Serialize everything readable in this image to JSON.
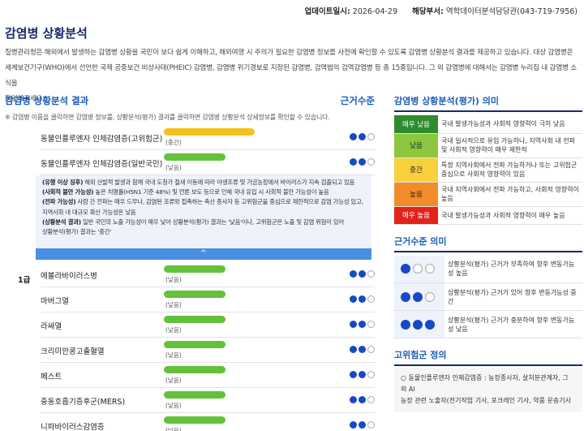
{
  "header": {
    "update_label": "업데이트일시:",
    "update_value": "2026-04-29",
    "dept_label": "해당부서:",
    "dept_value": "역학데이터분석담당관(043-719-7956)"
  },
  "page_title": "감염병 상황분석",
  "intro": [
    "질병관리청은 해외에서 발생하는 감염병 상황을 국민이 보다 쉽게 이해하고, 해외여행 시 주의가 필요한 감염병 정보를 사전에 확인할 수 있도록 감염병 상황분석 결과를 제공하고 있습니다. 대상 감염병은",
    "세계보건기구(WHO)에서 선언한 국제 공중보건 비상사태(PHEIC) 감염병, 감염병 위기경보로 지정된 감염병, 검역법의 검역감염병 등 총 15종입니다. 그 외 감염병에 대해서는 감염병 누리집 내 감염병 소식을",
    "확인해주세요."
  ],
  "left": {
    "title": "감염병 상황분석 결과",
    "evidence_col": "근거수준",
    "note": "※ 감염병 이름을 클릭하면 감염병 정보를, 상황분석(평가) 결과를 클릭하면 감염병 상황분석 상세정보를 확인할 수 있습니다.",
    "grade_label": "1급",
    "rows": [
      {
        "name": "동물인플루엔자 인체감염증(고위험군)",
        "level": "(중간)",
        "color": "yellow",
        "evidence": 2
      },
      {
        "name": "동물인플루엔자 인체감염증(일반국민)",
        "level": "(낮음)",
        "color": "green",
        "evidence": 2
      },
      {
        "name": "에볼라바이러스병",
        "level": "(낮음)",
        "color": "green",
        "evidence": 2
      },
      {
        "name": "마버그열",
        "level": "(낮음)",
        "color": "green",
        "evidence": 2
      },
      {
        "name": "라싸열",
        "level": "(낮음)",
        "color": "green",
        "evidence": 2
      },
      {
        "name": "크리미안콩고출혈열",
        "level": "(낮음)",
        "color": "green",
        "evidence": 2
      },
      {
        "name": "페스트",
        "level": "(낮음)",
        "color": "green",
        "evidence": 2
      },
      {
        "name": "중동호흡기증후군(MERS)",
        "level": "(낮음)",
        "color": "green",
        "evidence": 2
      },
      {
        "name": "니파바이러스감염증",
        "level": "(낮음)",
        "color": "green",
        "evidence": 2
      }
    ],
    "detail": [
      {
        "label": "(유행 이상 징후)",
        "text": " 해외 산발적 발생과 함께 국내 도청가 철새 이동에 따라 야생조류 및 가금농장에서 바이러스가 지속 검출되고 있음"
      },
      {
        "label": "(사회적 불안 가능성)",
        "text": " 높은 치명률(H5N1 기준 48%) 및 언론 보도 등으로 인해 국내 유입 시 사회적 불안 가능성이 높음"
      },
      {
        "label": "(전파 가능성)",
        "text": " 사람 간 전파는 매우 드무나, 감염된 조류와 접촉하는 축산 종사자 등 고위험군을 중심으로 제한적으로 감염 가능성 있고,"
      },
      {
        "label": "",
        "text": "지역사회 내 대규모 확산 가능성은 낮음"
      },
      {
        "label": "(상황분석 결과)",
        "text": " 일반 국민의 노출 가능성이 매우 낮아 상황분석(평가) 결과는 '낮음'이나, 고위험군은 노출 및 감염 위험이 있어"
      },
      {
        "label": "",
        "text": "상황분석(평가) 결과는 '중간'"
      }
    ],
    "collapse_symbol": "^"
  },
  "meaning": {
    "title": "감염병 상황분석(평가) 의미",
    "rows": [
      {
        "label": "매우 낮음",
        "color": "#2e8b2e",
        "text_color": "#ffffff",
        "desc": "국내 발생가능성과 사회적 영향력이 극히 낮음"
      },
      {
        "label": "낮음",
        "color": "#8dc63f",
        "text_color": "#222222",
        "desc": "국내 일시적으로 유입 가능하나, 지역사회 내 전파 및 사회적 영향력이 매우 제한적"
      },
      {
        "label": "중간",
        "color": "#f7d03c",
        "text_color": "#222222",
        "desc": "특정 지역사회에서 전파 가능하거나 또는 고위험군 중심으로 사회적 영향력이 있음"
      },
      {
        "label": "높음",
        "color": "#f28c28",
        "text_color": "#222222",
        "desc": "국내 지역사회에서 전파 가능하고, 사회적 영향력이 높음"
      },
      {
        "label": "매우 높음",
        "color": "#e2231a",
        "text_color": "#ffffff",
        "desc": "국내 발생가능성과 사회적 영향력이 매우 높음"
      }
    ]
  },
  "evidence": {
    "title": "근거수준 의미",
    "rows": [
      {
        "dots": 1,
        "desc": "상황분석(평가) 근거가 부족하여 향후 변동가능성 높음"
      },
      {
        "dots": 2,
        "desc": "상황분석(평가) 근거가 있어 향후 변동가능성 중간"
      },
      {
        "dots": 3,
        "desc": "상황분석(평가) 근거가 충분하여 향후 변동가능성 낮음"
      }
    ]
  },
  "high_risk": {
    "title": "고위험군 정의",
    "lines": [
      "○ 동물인플루엔자 인체감염증 : 농장종사자, 살처분관계자, 그 외 AI",
      "농장 관련 노출자(전기작업 기사, 포크레인 기사, 약품 운송기사"
    ]
  },
  "colors": {
    "accent": "#1a5db5",
    "dot": "#1848c5",
    "bar_green": "#63c13a",
    "bar_yellow": "#f4c21c"
  }
}
